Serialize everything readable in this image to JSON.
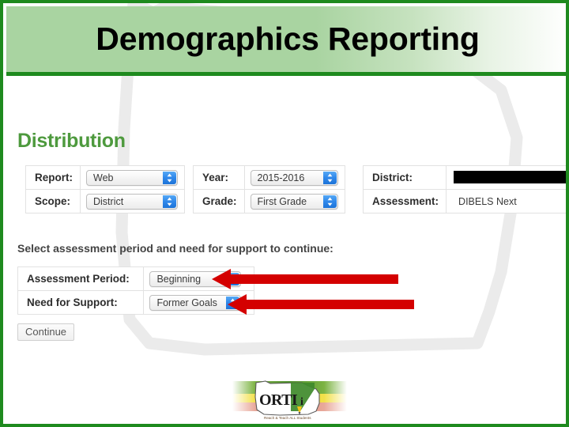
{
  "slide": {
    "title": "Demographics Reporting",
    "border_color": "#1e8a1e",
    "banner_color": "#a9d4a1"
  },
  "app": {
    "section_heading": "Distribution",
    "heading_color": "#4e9a3e",
    "distribution_table_left": {
      "rows": [
        {
          "label": "Report:",
          "control": "select",
          "value": "Web"
        },
        {
          "label": "Scope:",
          "control": "select",
          "value": "District"
        }
      ]
    },
    "distribution_table_middle": {
      "rows": [
        {
          "label": "Year:",
          "control": "select",
          "value": "2015-2016"
        },
        {
          "label": "Grade:",
          "control": "select",
          "value": "First Grade"
        }
      ]
    },
    "distribution_table_right": {
      "rows": [
        {
          "label": "District:",
          "control": "redacted",
          "value": ""
        },
        {
          "label": "Assessment:",
          "control": "text",
          "value": "DIBELS Next"
        }
      ]
    },
    "instruction": "Select assessment period and need for support to continue:",
    "selection_table": {
      "rows": [
        {
          "label": "Assessment Period:",
          "control": "select",
          "value": "Beginning"
        },
        {
          "label": "Need for Support:",
          "control": "select",
          "value": "Former Goals"
        }
      ]
    },
    "continue_label": "Continue"
  },
  "annotations": {
    "arrow_color": "#d40000",
    "arrows": [
      {
        "name": "arrow-to-assessment-period",
        "target": "Assessment Period"
      },
      {
        "name": "arrow-to-need-for-support",
        "target": "Need for Support"
      }
    ]
  },
  "footer": {
    "logo_text": "ORTIi",
    "logo_tagline": "Reach & Teach ALL Students"
  }
}
